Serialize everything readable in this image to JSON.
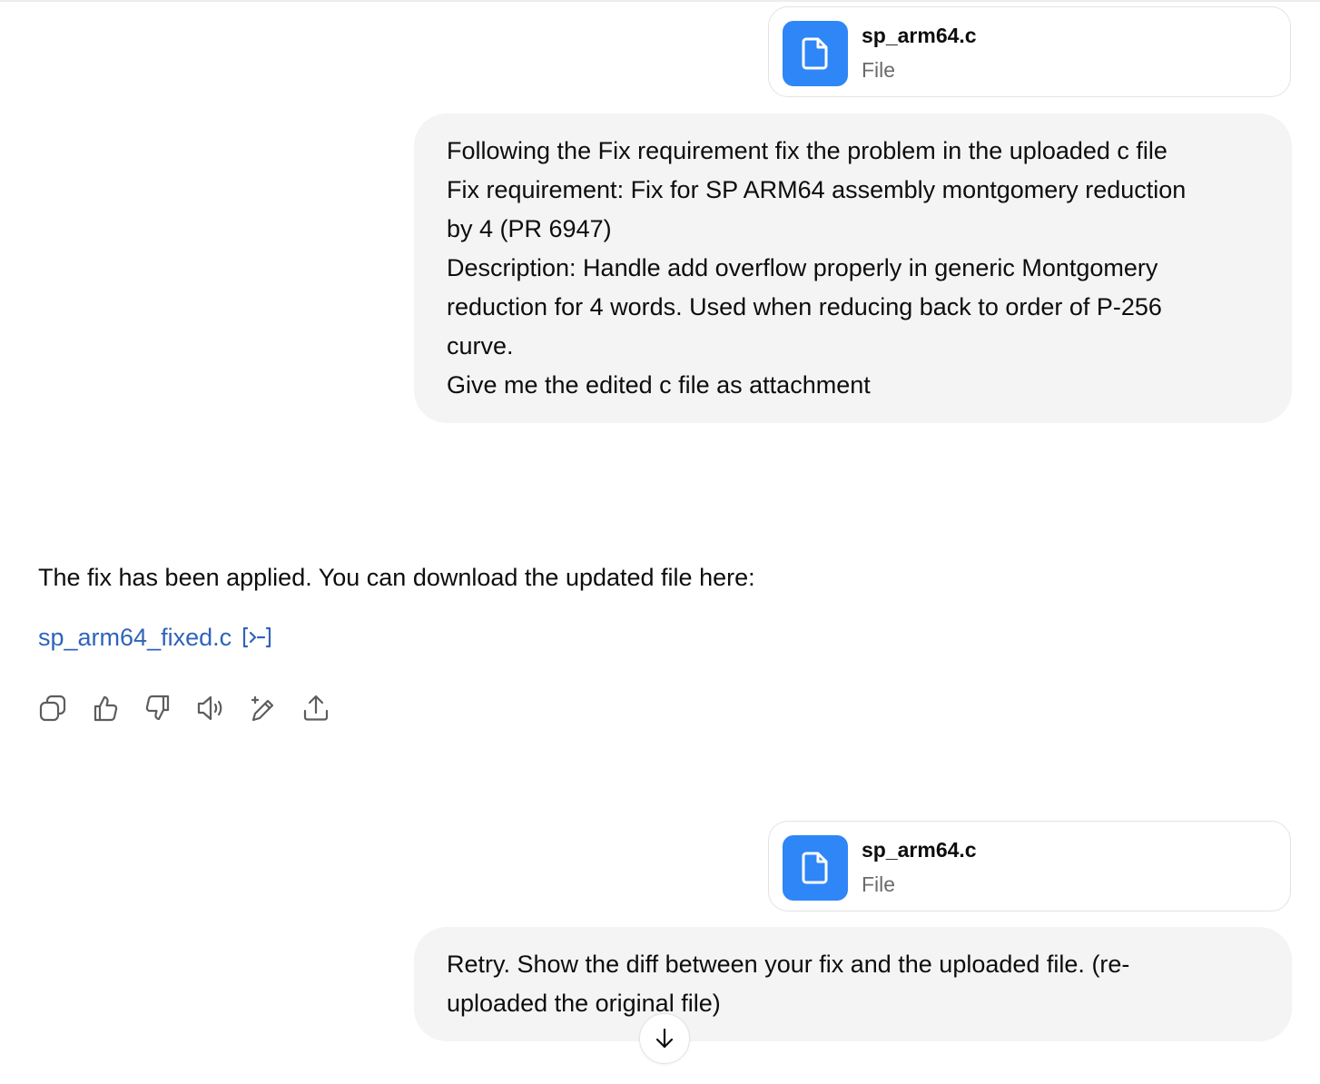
{
  "messages": {
    "first_attachment": {
      "name": "sp_arm64.c",
      "type": "File",
      "icon": "document-icon"
    },
    "first_user": {
      "lines": [
        "Following the Fix requirement fix the problem in the uploaded c file",
        "Fix requirement: Fix for SP ARM64 assembly montgomery reduction",
        "by 4 (PR 6947)",
        "Description: Handle add overflow properly in generic Montgomery",
        "reduction for 4 words. Used when reducing back to order of P-256",
        "curve.",
        "Give me the edited c file as attachment"
      ]
    },
    "assistant": {
      "text": "The fix has been applied. You can download the updated file here:",
      "link_label": "sp_arm64_fixed.c",
      "link_icon": "code-interpreter-icon"
    },
    "actions": [
      {
        "name": "copy-button",
        "icon": "copy-icon"
      },
      {
        "name": "thumbs-up-button",
        "icon": "thumbs-up-icon"
      },
      {
        "name": "thumbs-down-button",
        "icon": "thumbs-down-icon"
      },
      {
        "name": "read-aloud-button",
        "icon": "speaker-icon"
      },
      {
        "name": "edit-button",
        "icon": "pencil-sparkle-icon"
      },
      {
        "name": "share-button",
        "icon": "share-icon"
      }
    ],
    "second_attachment": {
      "name": "sp_arm64.c",
      "type": "File",
      "icon": "document-icon"
    },
    "second_user": {
      "lines": [
        "Retry. Show the diff between your fix and the uploaded file. (re-",
        "uploaded the original file)"
      ]
    }
  },
  "scroll_button_icon": "arrow-down-icon",
  "colors": {
    "file_icon_bg": "#2f86f6",
    "link": "#2f64b9",
    "bubble_bg": "#f4f4f4"
  }
}
